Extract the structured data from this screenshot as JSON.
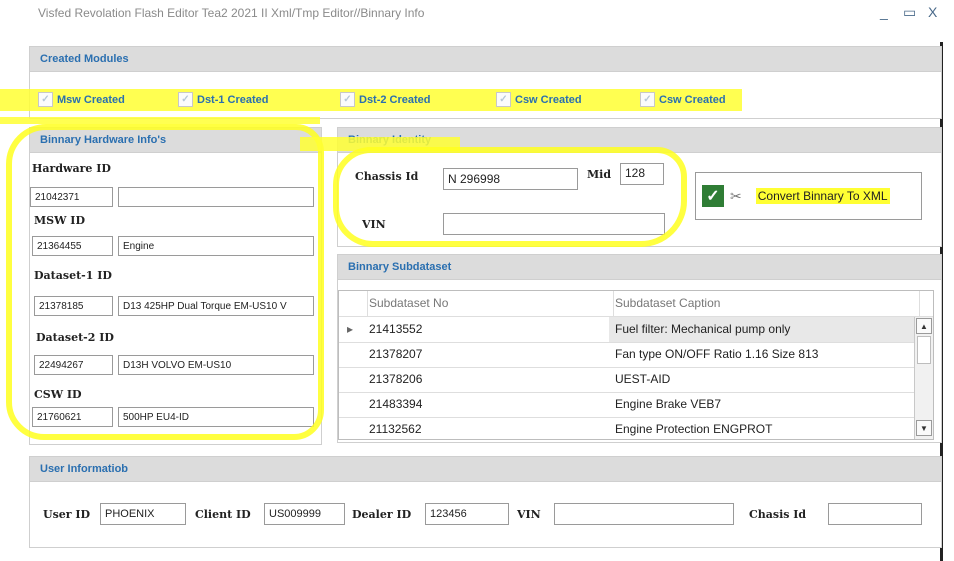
{
  "window": {
    "title": "Visfed Revolation Flash Editor Tea2 2021 II Xml/Tmp Editor//Binnary  Info",
    "minimize": "_",
    "maximize": "▭",
    "close": "X"
  },
  "created_modules": {
    "header": "Created Modules",
    "checks": [
      {
        "label": "Msw Created",
        "checked": true
      },
      {
        "label": "Dst-1 Created",
        "checked": true
      },
      {
        "label": "Dst-2 Created",
        "checked": true
      },
      {
        "label": "Csw Created",
        "checked": true
      },
      {
        "label": "Csw Created",
        "checked": true
      }
    ]
  },
  "hardware": {
    "header": "Binnary Hardware Info's",
    "hardware_id_label": "Hardware ID",
    "hardware_id": "21042371",
    "hardware_desc": "",
    "msw_id_label": "MSW ID",
    "msw_id": "21364455",
    "msw_desc": "Engine",
    "dataset1_label": "Dataset-1 ID",
    "dataset1_id": "21378185",
    "dataset1_desc": "D13 425HP Dual Torque EM-US10 V",
    "dataset2_label": "Dataset-2 ID",
    "dataset2_id": "22494267",
    "dataset2_desc": "D13H VOLVO EM-US10",
    "csw_label": "CSW ID",
    "csw_id": "21760621",
    "csw_desc": "500HP EU4-ID"
  },
  "identity": {
    "header": "Binnary Identity",
    "chassis_label": "Chassis Id",
    "chassis_value": "N  296998",
    "mid_label": "Mid",
    "mid_value": "128",
    "vin_label": "VIN",
    "vin_value": "",
    "convert_label": "Convert Binnary To XML",
    "convert_icon": "excel-convert-icon"
  },
  "subdataset": {
    "header": "Binnary Subdataset",
    "columns": [
      "Subdataset No",
      "Subdataset Caption"
    ],
    "rows": [
      {
        "no": "21413552",
        "caption": "Fuel filter: Mechanical pump only"
      },
      {
        "no": "21378207",
        "caption": "Fan type ON/OFF Ratio 1.16 Size 813"
      },
      {
        "no": "21378206",
        "caption": "UEST-AID"
      },
      {
        "no": "21483394",
        "caption": "Engine Brake VEB7"
      },
      {
        "no": "21132562",
        "caption": "Engine Protection ENGPROT"
      }
    ],
    "row_indicator": "▸"
  },
  "user": {
    "header": "User Informatiob",
    "user_id_label": "User ID",
    "user_id": "PHOENIX",
    "client_id_label": "Client ID",
    "client_id": "US009999",
    "dealer_id_label": "Dealer ID",
    "dealer_id": "123456",
    "vin_label": "VIN",
    "vin_value": "",
    "chasis_label": "Chasis Id",
    "chasis_value": ""
  },
  "colors": {
    "header_text": "#2a6fb0",
    "highlight": "#ffff33",
    "excel_green": "#2f7d35"
  }
}
